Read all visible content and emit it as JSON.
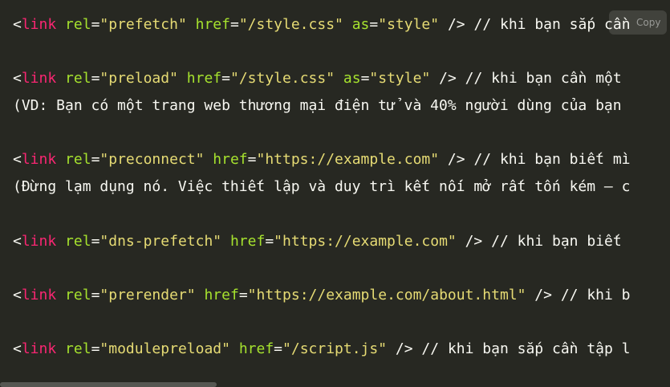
{
  "copy_button": {
    "label": "Copy"
  },
  "code_lines": [
    [
      {
        "t": "punct",
        "v": "<"
      },
      {
        "t": "tag",
        "v": "link"
      },
      {
        "t": "plain",
        "v": " "
      },
      {
        "t": "attr",
        "v": "rel"
      },
      {
        "t": "punct",
        "v": "="
      },
      {
        "t": "str",
        "v": "\"prefetch\""
      },
      {
        "t": "plain",
        "v": " "
      },
      {
        "t": "attr",
        "v": "href"
      },
      {
        "t": "punct",
        "v": "="
      },
      {
        "t": "str",
        "v": "\"/style.css\""
      },
      {
        "t": "plain",
        "v": " "
      },
      {
        "t": "attr",
        "v": "as"
      },
      {
        "t": "punct",
        "v": "="
      },
      {
        "t": "str",
        "v": "\"style\""
      },
      {
        "t": "plain",
        "v": " "
      },
      {
        "t": "punct",
        "v": "/>"
      },
      {
        "t": "comment",
        "v": " // khi bạn sắp cần"
      }
    ],
    [],
    [
      {
        "t": "punct",
        "v": "<"
      },
      {
        "t": "tag",
        "v": "link"
      },
      {
        "t": "plain",
        "v": " "
      },
      {
        "t": "attr",
        "v": "rel"
      },
      {
        "t": "punct",
        "v": "="
      },
      {
        "t": "str",
        "v": "\"preload\""
      },
      {
        "t": "plain",
        "v": " "
      },
      {
        "t": "attr",
        "v": "href"
      },
      {
        "t": "punct",
        "v": "="
      },
      {
        "t": "str",
        "v": "\"/style.css\""
      },
      {
        "t": "plain",
        "v": " "
      },
      {
        "t": "attr",
        "v": "as"
      },
      {
        "t": "punct",
        "v": "="
      },
      {
        "t": "str",
        "v": "\"style\""
      },
      {
        "t": "plain",
        "v": " "
      },
      {
        "t": "punct",
        "v": "/>"
      },
      {
        "t": "comment",
        "v": " // khi bạn cần một"
      }
    ],
    [
      {
        "t": "comment",
        "v": "(VD: Bạn có một trang web thương mại điện tử và 40% người dùng của bạn"
      }
    ],
    [],
    [
      {
        "t": "punct",
        "v": "<"
      },
      {
        "t": "tag",
        "v": "link"
      },
      {
        "t": "plain",
        "v": " "
      },
      {
        "t": "attr",
        "v": "rel"
      },
      {
        "t": "punct",
        "v": "="
      },
      {
        "t": "str",
        "v": "\"preconnect\""
      },
      {
        "t": "plain",
        "v": " "
      },
      {
        "t": "attr",
        "v": "href"
      },
      {
        "t": "punct",
        "v": "="
      },
      {
        "t": "str",
        "v": "\"https://example.com\""
      },
      {
        "t": "plain",
        "v": " "
      },
      {
        "t": "punct",
        "v": "/>"
      },
      {
        "t": "comment",
        "v": " // khi bạn biết mì"
      }
    ],
    [
      {
        "t": "comment",
        "v": "(Đừng lạm dụng nó. Việc thiết lập và duy trì kết nối mở rất tốn kém — c"
      }
    ],
    [],
    [
      {
        "t": "punct",
        "v": "<"
      },
      {
        "t": "tag",
        "v": "link"
      },
      {
        "t": "plain",
        "v": " "
      },
      {
        "t": "attr",
        "v": "rel"
      },
      {
        "t": "punct",
        "v": "="
      },
      {
        "t": "str",
        "v": "\"dns-prefetch\""
      },
      {
        "t": "plain",
        "v": " "
      },
      {
        "t": "attr",
        "v": "href"
      },
      {
        "t": "punct",
        "v": "="
      },
      {
        "t": "str",
        "v": "\"https://example.com\""
      },
      {
        "t": "plain",
        "v": " "
      },
      {
        "t": "punct",
        "v": "/>"
      },
      {
        "t": "comment",
        "v": " // khi bạn biết"
      }
    ],
    [],
    [
      {
        "t": "punct",
        "v": "<"
      },
      {
        "t": "tag",
        "v": "link"
      },
      {
        "t": "plain",
        "v": " "
      },
      {
        "t": "attr",
        "v": "rel"
      },
      {
        "t": "punct",
        "v": "="
      },
      {
        "t": "str",
        "v": "\"prerender\""
      },
      {
        "t": "plain",
        "v": " "
      },
      {
        "t": "attr",
        "v": "href"
      },
      {
        "t": "punct",
        "v": "="
      },
      {
        "t": "str",
        "v": "\"https://example.com/about.html\""
      },
      {
        "t": "plain",
        "v": " "
      },
      {
        "t": "punct",
        "v": "/>"
      },
      {
        "t": "comment",
        "v": " // khi b"
      }
    ],
    [],
    [
      {
        "t": "punct",
        "v": "<"
      },
      {
        "t": "tag",
        "v": "link"
      },
      {
        "t": "plain",
        "v": " "
      },
      {
        "t": "attr",
        "v": "rel"
      },
      {
        "t": "punct",
        "v": "="
      },
      {
        "t": "str",
        "v": "\"modulepreload\""
      },
      {
        "t": "plain",
        "v": " "
      },
      {
        "t": "attr",
        "v": "href"
      },
      {
        "t": "punct",
        "v": "="
      },
      {
        "t": "str",
        "v": "\"/script.js\""
      },
      {
        "t": "plain",
        "v": " "
      },
      {
        "t": "punct",
        "v": "/>"
      },
      {
        "t": "comment",
        "v": " // khi bạn sắp cần tập l"
      }
    ]
  ],
  "colors": {
    "background": "#272822",
    "tag": "#f92672",
    "attribute": "#a6e22e",
    "string": "#e6db74",
    "text": "#f8f8f2"
  }
}
